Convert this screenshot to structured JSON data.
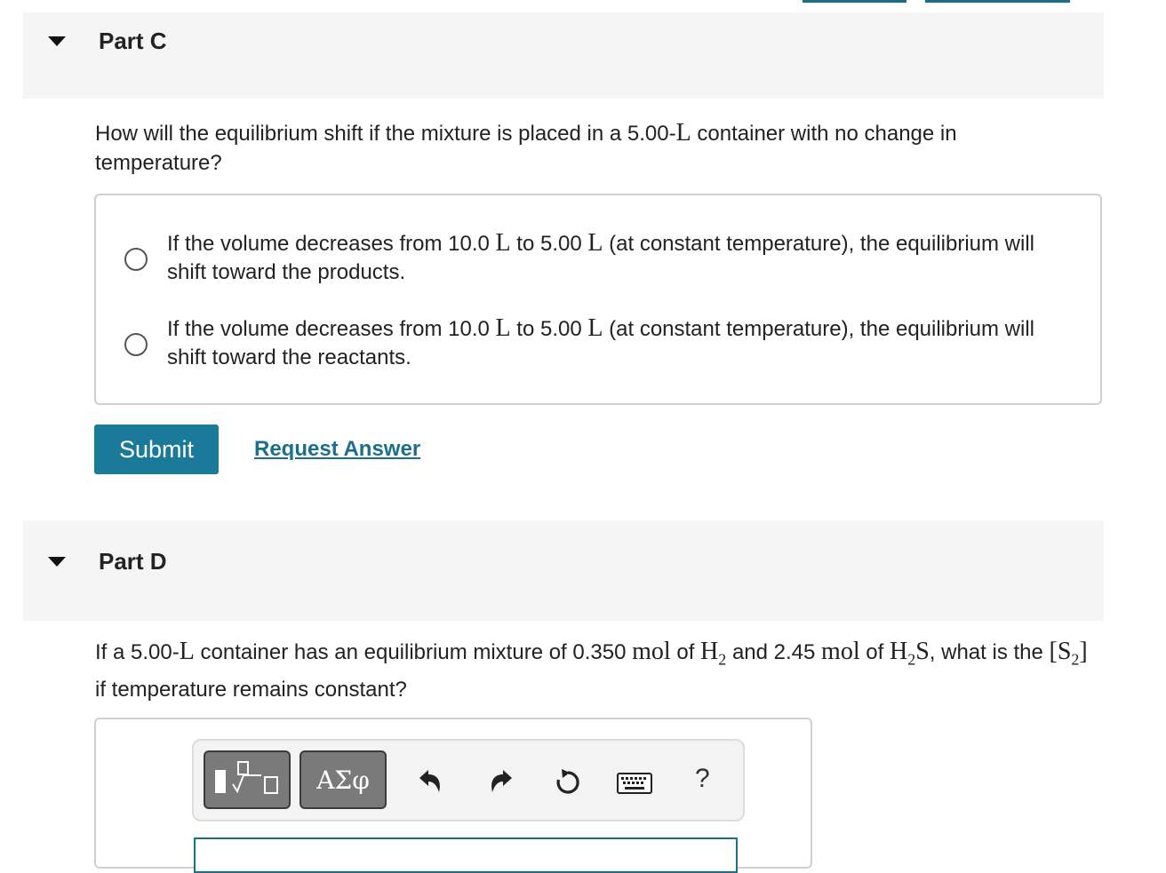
{
  "partC": {
    "title": "Part C",
    "question": {
      "before": "How will the equilibrium shift if the mixture is placed in a 5.00-",
      "unit": "L",
      "after": " container with no change in temperature?"
    },
    "choices": [
      {
        "p1": "If the volume decreases from 10.0 ",
        "u1": "L",
        "p2": " to 5.00 ",
        "u2": "L",
        "p3": " (at constant temperature), the equilibrium will shift toward the products."
      },
      {
        "p1": "If the volume decreases from 10.0 ",
        "u1": "L",
        "p2": " to 5.00 ",
        "u2": "L",
        "p3": " (at constant temperature), the equilibrium will shift toward the reactants."
      }
    ],
    "submit_label": "Submit",
    "request_answer_label": "Request Answer"
  },
  "partD": {
    "title": "Part D",
    "question": {
      "t1": "If a 5.00-",
      "m1": "L",
      "t2": " container has an equilibrium mixture of 0.350 ",
      "m2": "mol",
      "t3": " of ",
      "m3": "H",
      "m3sub": "2",
      "t4": " and 2.45 ",
      "m4": "mol",
      "t5": " of ",
      "m5a": "H",
      "m5sub": "2",
      "m5b": "S",
      "t6": ", what is the ",
      "m6open": "[",
      "m6": "S",
      "m6sub": "2",
      "m6close": "]",
      "t7": " if temperature remains constant?"
    },
    "toolbar": {
      "greek_label": "ΑΣφ",
      "help_label": "?",
      "icons": [
        "templates-icon",
        "greek-letters-icon",
        "undo-icon",
        "redo-icon",
        "reset-icon",
        "keyboard-icon",
        "help-icon"
      ]
    }
  }
}
